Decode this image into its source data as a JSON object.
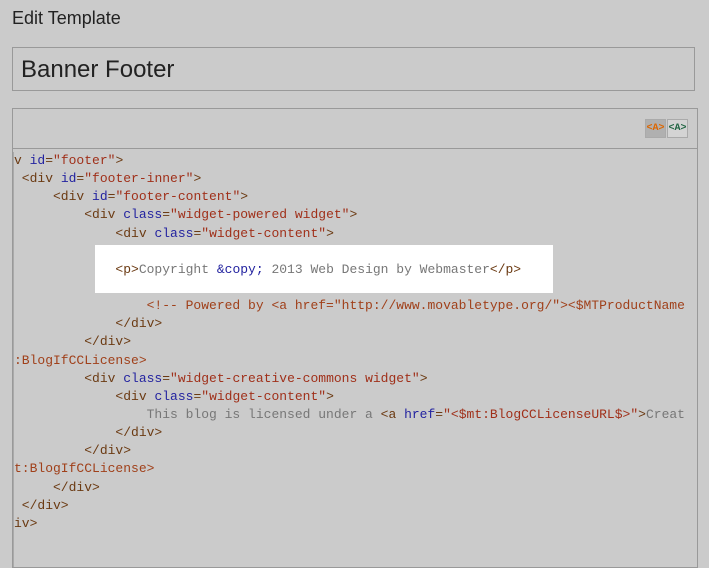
{
  "page_title": "Edit Template",
  "template_name": "Banner Footer",
  "toolbar": {
    "highlight_on": "<A>",
    "highlight_off": "<A>"
  },
  "code_lines": [
    [
      [
        "t",
        "v "
      ],
      [
        "a",
        "id"
      ],
      [
        "t",
        "="
      ],
      [
        "s",
        "\"footer\""
      ],
      [
        "t",
        ">"
      ]
    ],
    [
      [
        "t",
        " <div "
      ],
      [
        "a",
        "id"
      ],
      [
        "t",
        "="
      ],
      [
        "s",
        "\"footer-inner\""
      ],
      [
        "t",
        ">"
      ]
    ],
    [
      [
        "t",
        "     <div "
      ],
      [
        "a",
        "id"
      ],
      [
        "t",
        "="
      ],
      [
        "s",
        "\"footer-content\""
      ],
      [
        "t",
        ">"
      ]
    ],
    [
      [
        "t",
        "         <div "
      ],
      [
        "a",
        "class"
      ],
      [
        "t",
        "="
      ],
      [
        "s",
        "\"widget-powered widget\""
      ],
      [
        "t",
        ">"
      ]
    ],
    [
      [
        "t",
        "             <div "
      ],
      [
        "a",
        "class"
      ],
      [
        "t",
        "="
      ],
      [
        "s",
        "\"widget-content\""
      ],
      [
        "t",
        ">"
      ]
    ],
    [],
    [
      [
        "t",
        "             <p>"
      ],
      [
        "x",
        "Copyright "
      ],
      [
        "e",
        "&copy;"
      ],
      [
        "x",
        " 2013 Web Design by Webmaster"
      ],
      [
        "t",
        "</p>"
      ]
    ],
    [],
    [
      [
        "c",
        "                 <!-- Powered by <a href=\"http://www.movabletype.org/\"><$MTProductName"
      ]
    ],
    [
      [
        "t",
        "             </div>"
      ]
    ],
    [
      [
        "t",
        "         </div>"
      ]
    ],
    [
      [
        "c",
        ":BlogIfCCLicense>"
      ]
    ],
    [
      [
        "t",
        "         <div "
      ],
      [
        "a",
        "class"
      ],
      [
        "t",
        "="
      ],
      [
        "s",
        "\"widget-creative-commons widget\""
      ],
      [
        "t",
        ">"
      ]
    ],
    [
      [
        "t",
        "             <div "
      ],
      [
        "a",
        "class"
      ],
      [
        "t",
        "="
      ],
      [
        "s",
        "\"widget-content\""
      ],
      [
        "t",
        ">"
      ]
    ],
    [
      [
        "x",
        "                 This blog is licensed under a "
      ],
      [
        "t",
        "<a "
      ],
      [
        "a",
        "href"
      ],
      [
        "t",
        "="
      ],
      [
        "s",
        "\"<$mt:BlogCCLicenseURL$>\""
      ],
      [
        "t",
        ">"
      ],
      [
        "x",
        "Creat"
      ]
    ],
    [
      [
        "t",
        "             </div>"
      ]
    ],
    [
      [
        "t",
        "         </div>"
      ]
    ],
    [
      [
        "c",
        "t:BlogIfCCLicense>"
      ]
    ],
    [
      [
        "t",
        "     </div>"
      ]
    ],
    [
      [
        "t",
        " </div>"
      ]
    ],
    [
      [
        "t",
        "iv>"
      ]
    ]
  ]
}
